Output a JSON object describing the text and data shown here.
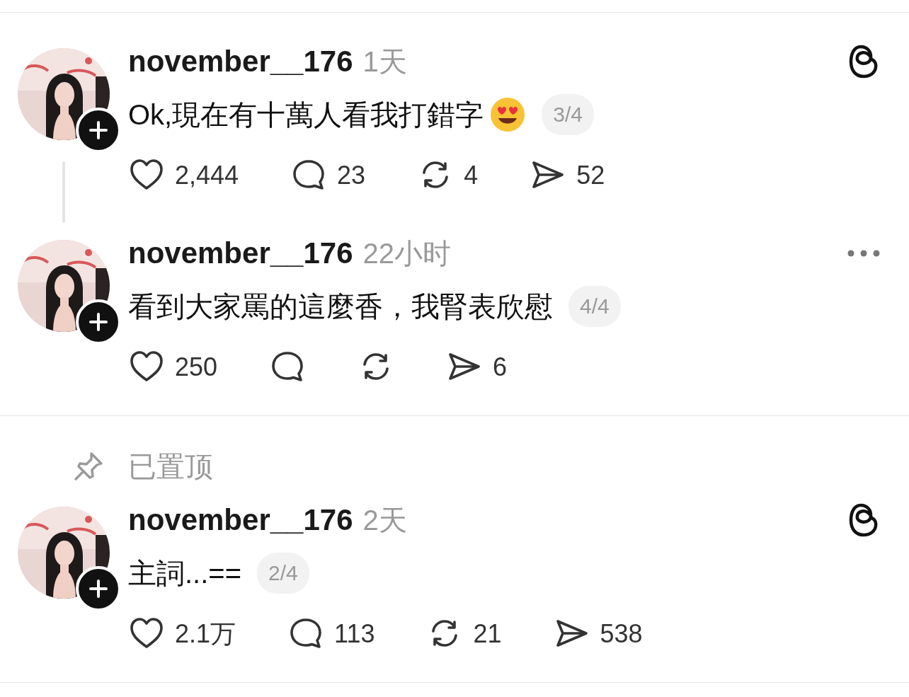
{
  "posts": [
    {
      "username": "november__176",
      "time": "1天",
      "threads_logo": true,
      "more_menu": false,
      "thread_line": true,
      "divider_after": false,
      "text": "Ok,現在有十萬人看我打錯字",
      "heart_eyes_emoji": true,
      "page": "3/4",
      "likes": "2,444",
      "replies": "23",
      "reposts": "4",
      "shares": "52"
    },
    {
      "username": "november__176",
      "time": "22小时",
      "threads_logo": false,
      "more_menu": true,
      "thread_line": false,
      "divider_after": true,
      "text": "看到大家罵的這麼香，我腎表欣慰",
      "heart_eyes_emoji": false,
      "page": "4/4",
      "likes": "250",
      "shares": "6"
    },
    {
      "pinned": "已置顶",
      "username": "november__176",
      "time": "2天",
      "threads_logo": true,
      "more_menu": false,
      "thread_line": false,
      "divider_after": true,
      "text": "主詞...==",
      "heart_eyes_emoji": false,
      "page": "2/4",
      "likes": "2.1万",
      "replies": "113",
      "reposts": "21",
      "shares": "538"
    }
  ]
}
